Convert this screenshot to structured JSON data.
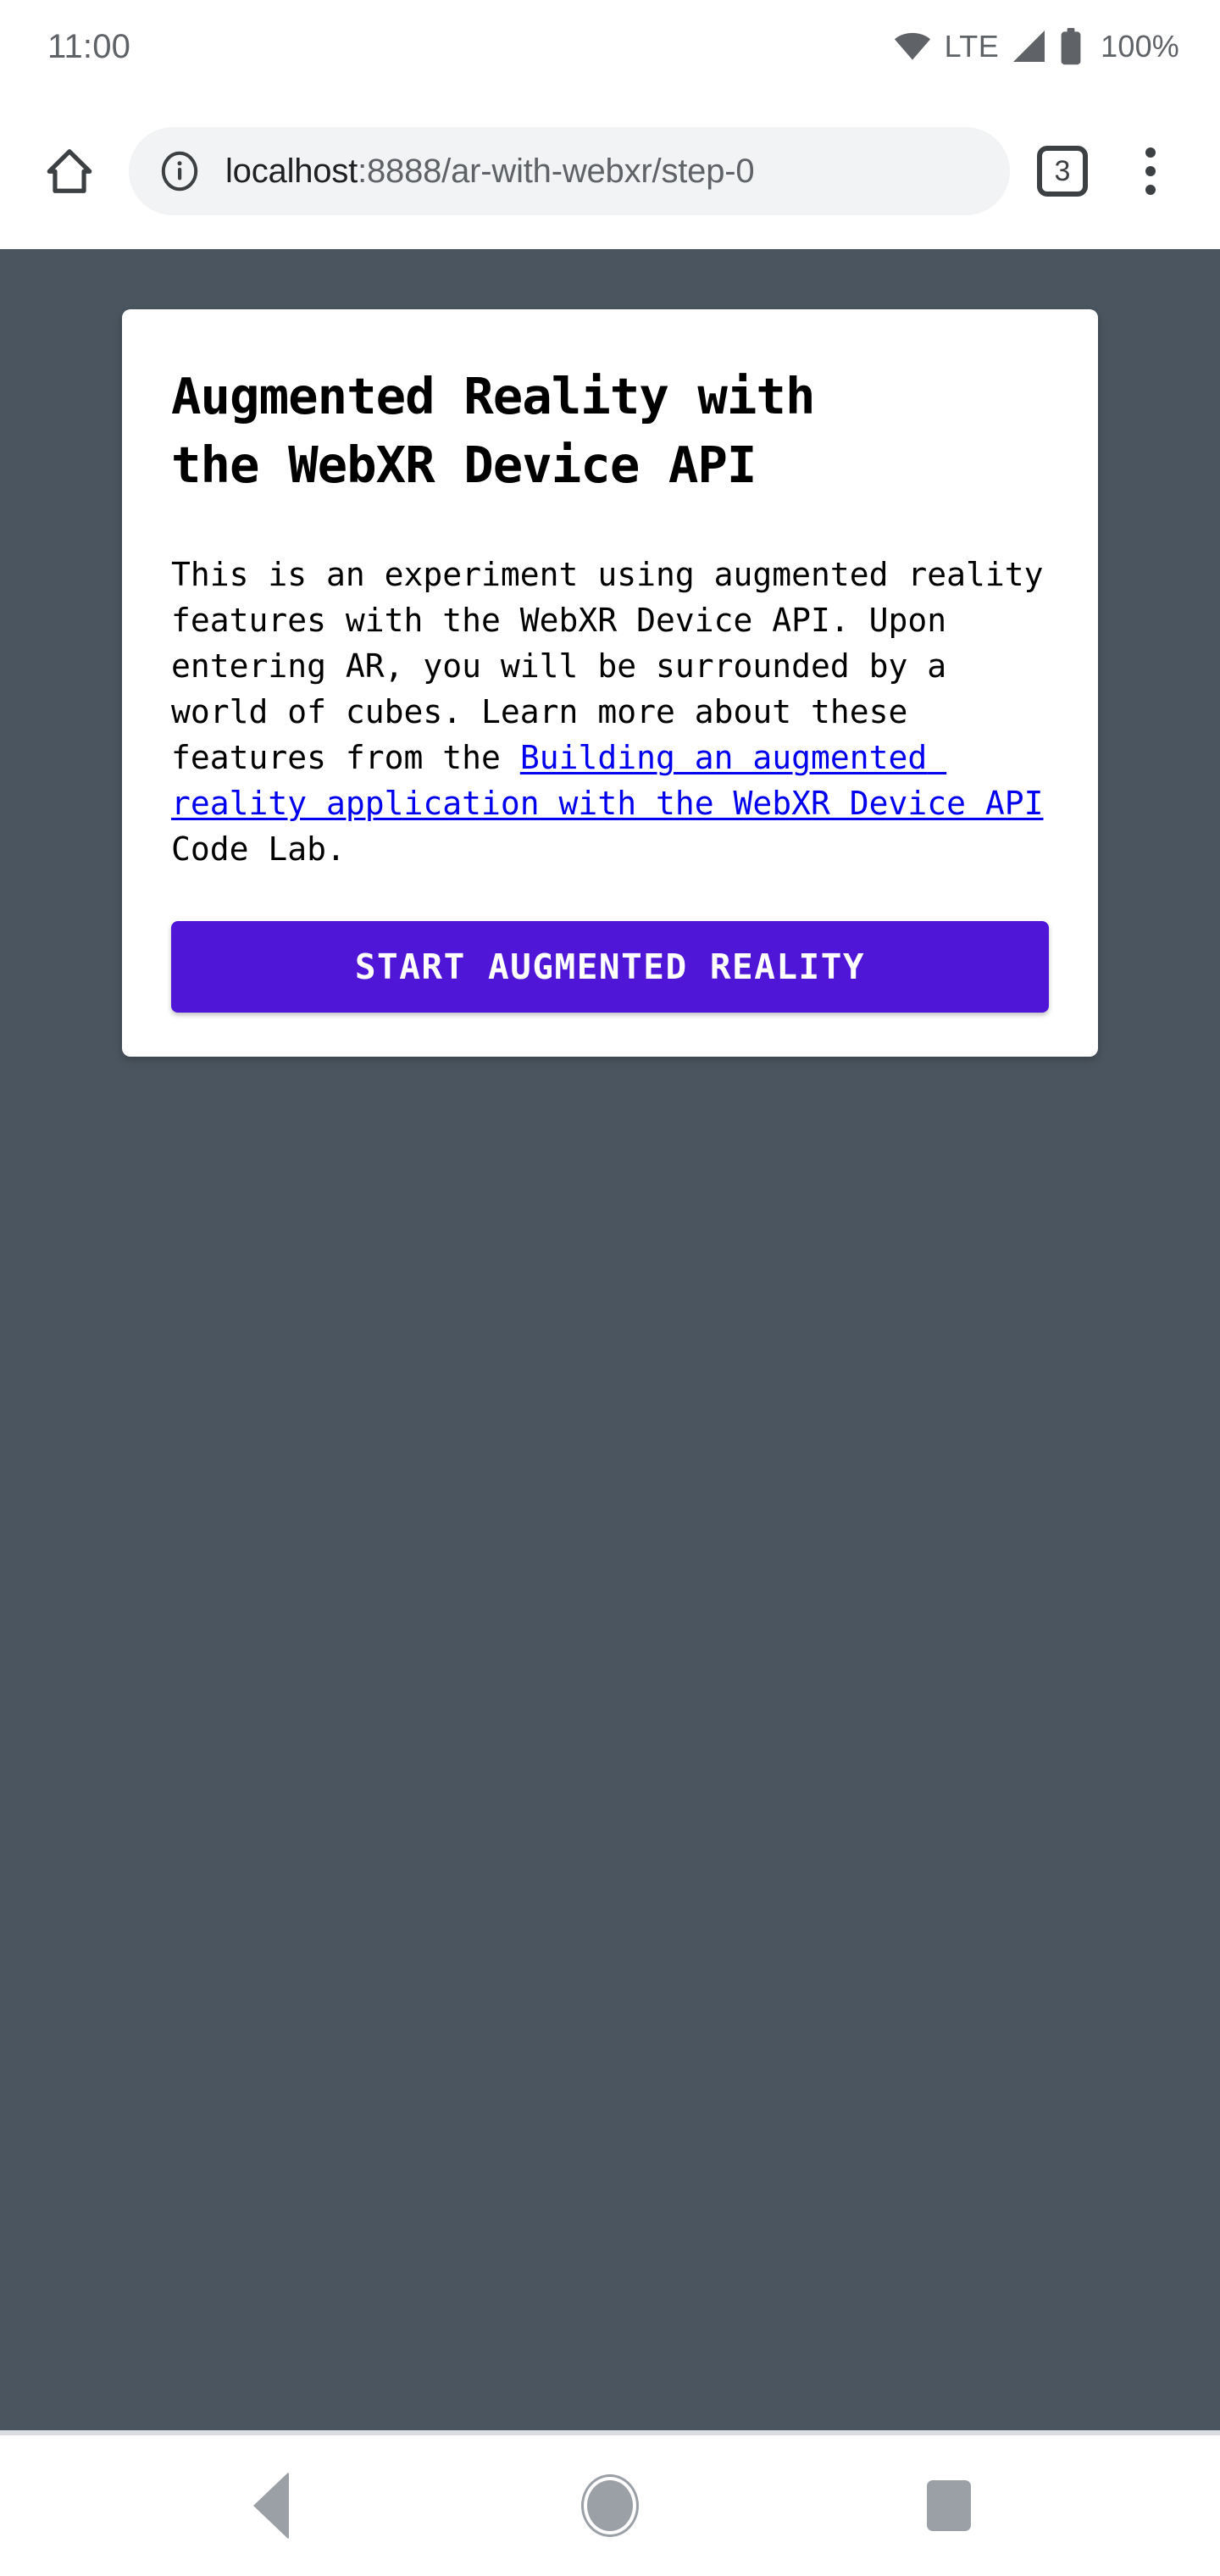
{
  "status_bar": {
    "clock": "11:00",
    "network_label": "LTE",
    "battery_label": "100%",
    "icons": {
      "wifi": "wifi-icon",
      "signal": "cell-signal-icon",
      "battery": "battery-full-icon"
    }
  },
  "browser": {
    "home_icon": "home-icon",
    "info_icon": "page-info-icon",
    "url_host": "localhost",
    "url_path": ":8888/ar-with-webxr/step-0",
    "url_full": "localhost:8888/ar-with-webxr/step-0",
    "tab_count": "3",
    "menu_icon": "overflow-menu-icon"
  },
  "page": {
    "background_color": "#4b555f",
    "card": {
      "title": "Augmented Reality with\nthe WebXR Device API",
      "body_before_link": "This is an experiment using augmented reality features with the WebXR Device API. Upon entering AR, you will be surrounded by a world of cubes. Learn more about these features from the ",
      "link_text": "Building an augmented reality application with the WebXR Device API",
      "body_after_link": " Code Lab.",
      "button_label": "START AUGMENTED REALITY",
      "button_color": "#5016d8",
      "link_color": "#0000ee"
    }
  },
  "nav_bar": {
    "back_label": "back-button",
    "home_label": "home-button",
    "recents_label": "recents-button"
  }
}
